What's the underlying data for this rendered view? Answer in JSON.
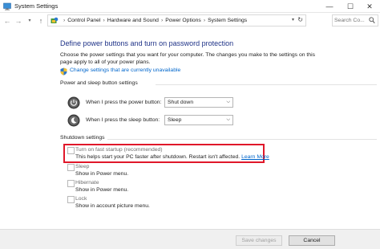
{
  "window": {
    "title": "System Settings",
    "minimize": "—",
    "maximize": "☐",
    "close": "✕"
  },
  "nav": {
    "back": "←",
    "forward": "→",
    "history": "▾",
    "up": "↑"
  },
  "address": {
    "breadcrumbs": [
      "Control Panel",
      "Hardware and Sound",
      "Power Options",
      "System Settings"
    ],
    "separator": "›",
    "dropdown": "▾",
    "refresh": "↻"
  },
  "search": {
    "placeholder": "Search Co..."
  },
  "page": {
    "heading": "Define power buttons and turn on password protection",
    "description": "Choose the power settings that you want for your computer. The changes you make to the settings on this page apply to all of your power plans.",
    "change_link": "Change settings that are currently unavailable"
  },
  "power_section": {
    "label": "Power and sleep button settings",
    "power_button": {
      "label": "When I press the power button:",
      "value": "Shut down"
    },
    "sleep_button": {
      "label": "When I press the sleep button:",
      "value": "Sleep"
    }
  },
  "shutdown_section": {
    "label": "Shutdown settings",
    "options": [
      {
        "label": "Turn on fast startup (recommended)",
        "checked": false,
        "disabled": true,
        "sub": "This helps start your PC faster after shutdown. Restart isn't affected.",
        "link": "Learn More"
      },
      {
        "label": "Sleep",
        "checked": false,
        "disabled": true,
        "sub": "Show in Power menu."
      },
      {
        "label": "Hibernate",
        "checked": false,
        "disabled": true,
        "sub": "Show in Power menu."
      },
      {
        "label": "Lock",
        "checked": false,
        "disabled": true,
        "sub": "Show in account picture menu."
      }
    ]
  },
  "footer": {
    "save": "Save changes",
    "cancel": "Cancel"
  },
  "colors": {
    "heading": "#1e3287",
    "link": "#0066cc",
    "highlight": "#e0182a"
  }
}
